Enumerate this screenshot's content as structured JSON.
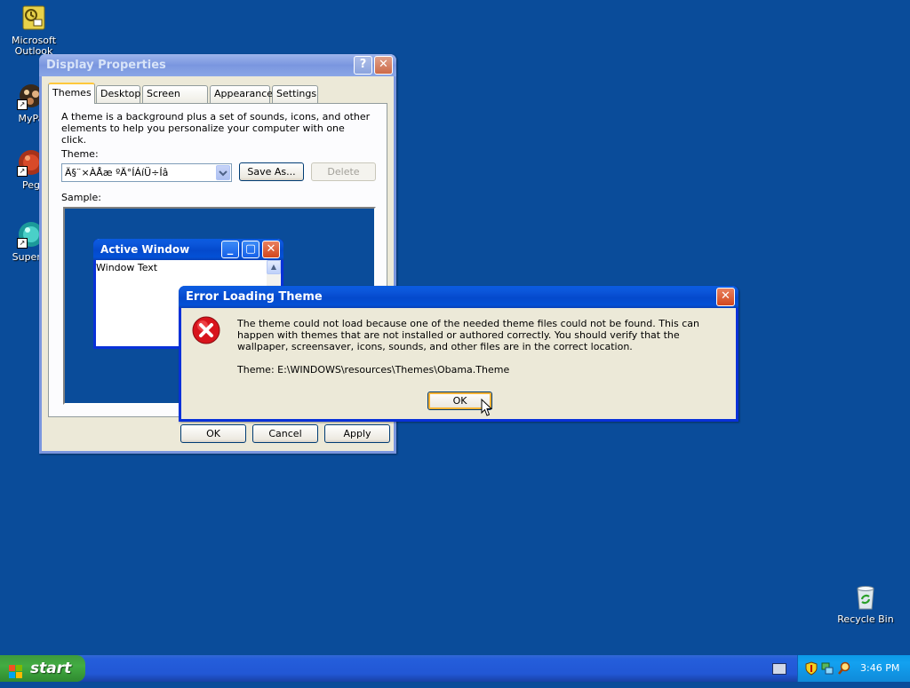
{
  "desktop": {
    "icons": [
      {
        "label": "Microsoft\nOutlook",
        "icon": "outlook-icon"
      },
      {
        "label": "MyPa",
        "icon": "mypa-icon"
      },
      {
        "label": "Peg",
        "icon": "peg-icon"
      },
      {
        "label": "Superm",
        "icon": "superm-icon"
      },
      {
        "label": "Recycle Bin",
        "icon": "recycle-bin-icon"
      }
    ]
  },
  "display_properties": {
    "title": "Display Properties",
    "tabs": [
      "Themes",
      "Desktop",
      "Screen Saver",
      "Appearance",
      "Settings"
    ],
    "selected_tab": "Themes",
    "description": "A theme is a background plus a set of sounds, icons, and other elements to help you personalize your computer with one click.",
    "theme_label": "Theme:",
    "theme_value": "Ä§¨×ÀÅæ ºÄ°ÍÁíÜ÷Íâ",
    "save_as_label": "Save As...",
    "delete_label": "Delete",
    "sample_label": "Sample:",
    "sample_window_title": "Active Window",
    "sample_window_text": "Window Text",
    "ok_label": "OK",
    "cancel_label": "Cancel",
    "apply_label": "Apply"
  },
  "error_dialog": {
    "title": "Error Loading Theme",
    "message": "The theme could not load because one of the needed theme files could not be found.  This can happen with themes that are not installed or authored correctly.  You should verify that the wallpaper, screensaver, icons, sounds, and other files are in the correct location.",
    "theme_path": "Theme: E:\\WINDOWS\\resources\\Themes\\Obama.Theme",
    "ok_label": "OK"
  },
  "taskbar": {
    "start_label": "start",
    "clock": "3:46 PM"
  },
  "colors": {
    "desktop": "#0a4c9a",
    "title_active": "#0449cc",
    "title_inactive": "#7a96df",
    "window_face": "#ece9d8",
    "close_red": "#d2471d",
    "error_icon": "#d8141c"
  }
}
